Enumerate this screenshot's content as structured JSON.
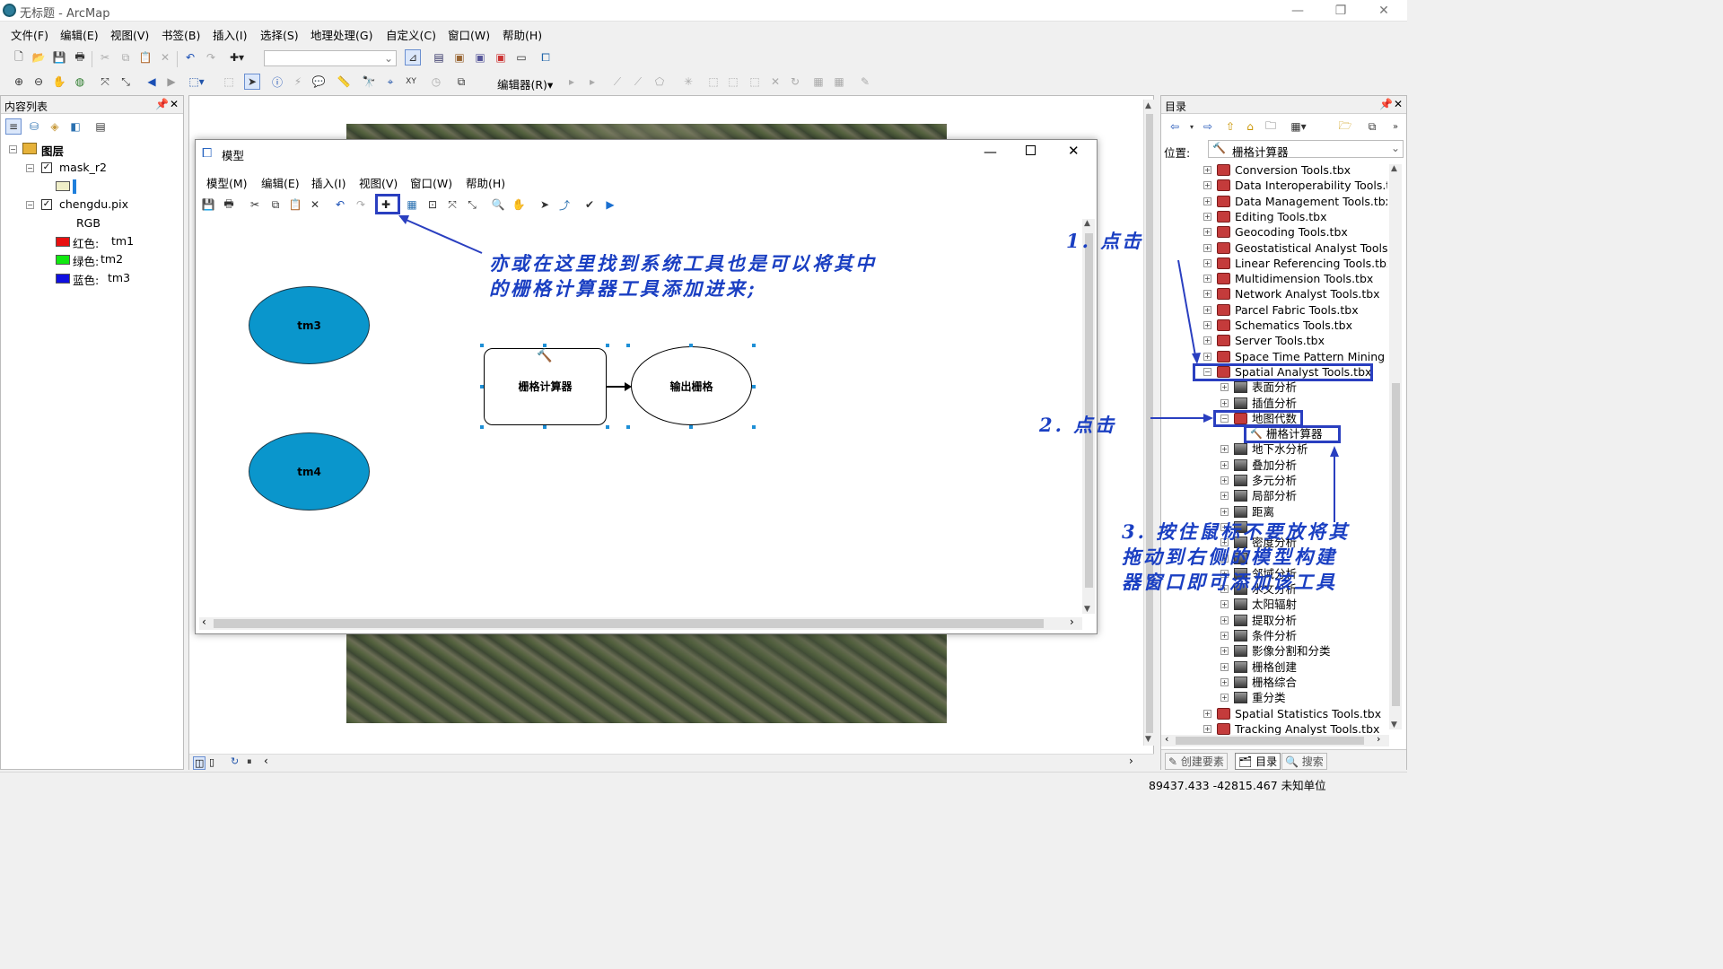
{
  "app": {
    "title": "无标题 - ArcMap",
    "min": "—",
    "max": "❐",
    "close": "✕"
  },
  "menubar": [
    "文件(F)",
    "编辑(E)",
    "视图(V)",
    "书签(B)",
    "插入(I)",
    "选择(S)",
    "地理处理(G)",
    "自定义(C)",
    "窗口(W)",
    "帮助(H)"
  ],
  "toolbar2": {
    "editor_label": "编辑器(R)▾"
  },
  "toc": {
    "title": "内容列表",
    "root": "图层",
    "layers": [
      {
        "name": "mask_r2"
      },
      {
        "name": "chengdu.pix",
        "sub": "RGB",
        "bands": [
          {
            "label": "红色:",
            "band": "tm1",
            "color": "#e81010"
          },
          {
            "label": "绿色:",
            "band": "tm2",
            "color": "#10e810"
          },
          {
            "label": "蓝色:",
            "band": "tm3",
            "color": "#1010e0"
          }
        ]
      }
    ]
  },
  "model": {
    "title": "模型",
    "menus": [
      "模型(M)",
      "编辑(E)",
      "插入(I)",
      "视图(V)",
      "窗口(W)",
      "帮助(H)"
    ],
    "nodes": {
      "tm3": "tm3",
      "tm4": "tm4",
      "tool": "栅格计算器",
      "output": "输出栅格"
    },
    "colors": {
      "input": "#0a96cc",
      "output": "#ffffff"
    }
  },
  "catalog": {
    "title": "目录",
    "location_label": "位置:",
    "location_value": "栅格计算器",
    "toolboxes_top": [
      "Conversion Tools.tbx",
      "Data Interoperability Tools.t",
      "Data Management Tools.tbx",
      "Editing Tools.tbx",
      "Geocoding Tools.tbx",
      "Geostatistical Analyst Tools.t",
      "Linear Referencing Tools.tbx",
      "Multidimension Tools.tbx",
      "Network Analyst Tools.tbx",
      "Parcel Fabric Tools.tbx",
      "Schematics Tools.tbx",
      "Server Tools.tbx",
      "Space Time Pattern Mining T"
    ],
    "spatial_analyst": "Spatial Analyst Tools.tbx",
    "toolsets_before": [
      "表面分析",
      "插值分析",
      "地图代数"
    ],
    "raster_calc": "栅格计算器",
    "toolsets_after": [
      "地下水分析",
      "叠加分析",
      "多元分析",
      "局部分析",
      "距离",
      "",
      "密度分析",
      "",
      "邻域分析",
      "水文分析",
      "太阳辐射",
      "提取分析",
      "条件分析",
      "影像分割和分类",
      "栅格创建",
      "栅格综合",
      "重分类"
    ],
    "toolboxes_bottom": [
      "Spatial Statistics Tools.tbx",
      "Tracking Analyst Tools.tbx"
    ],
    "tabs": [
      "创建要素",
      "目录",
      "搜索"
    ]
  },
  "annotations": {
    "a0_line1": "亦或在这里找到系统工具也是可以将其中",
    "a0_line2": "的栅格计算器工具添加进来;",
    "a1": "1. 点击",
    "a2": "2. 点击",
    "a3_line1": "3. 按住鼠标不要放将其",
    "a3_line2": "拖动到右侧的模型构建",
    "a3_line3": "器窗口即可添加该工具",
    "color": "#1a3fc2"
  },
  "status": {
    "coords": "89437.433  -42815.467 未知单位"
  }
}
